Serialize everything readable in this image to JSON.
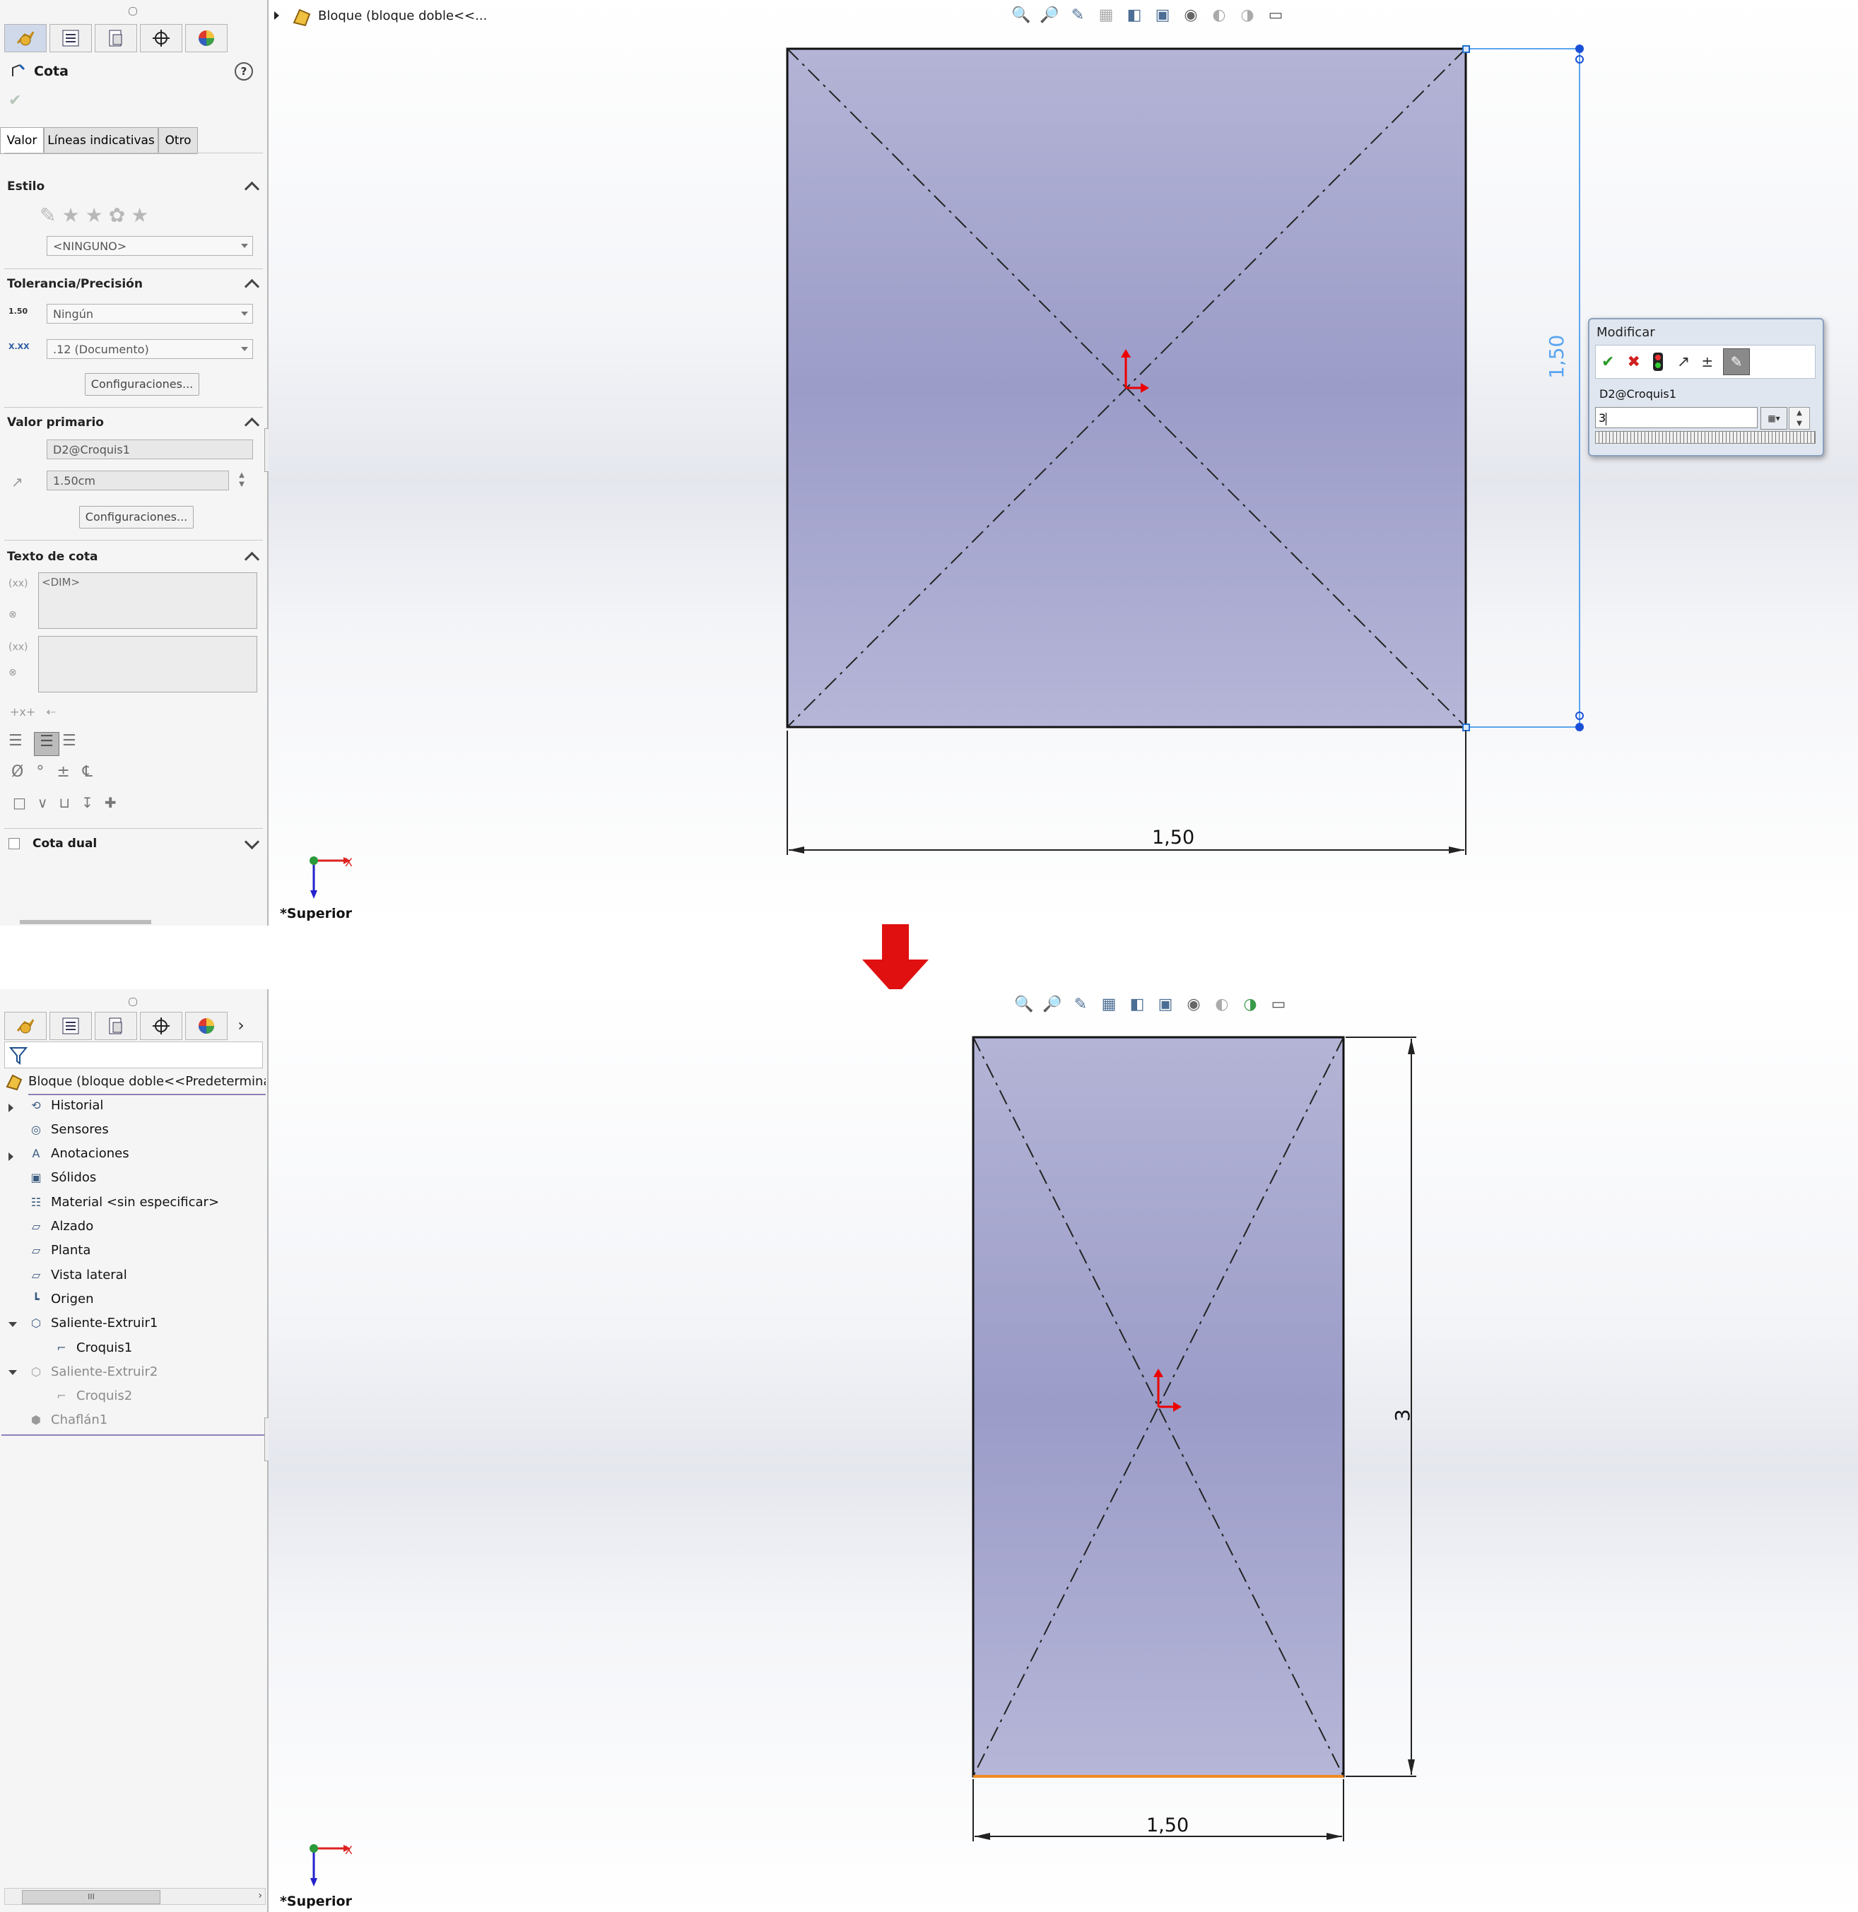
{
  "top": {
    "panel": {
      "title": "Cota",
      "help": "?",
      "tabs": [
        "Valor",
        "Líneas indicativas",
        "Otro"
      ],
      "estilo": {
        "title": "Estilo",
        "select": "<NINGUNO>"
      },
      "tolerancia": {
        "title": "Tolerancia/Precisión",
        "tol_select": "Ningún",
        "prec_select": ".12 (Documento)",
        "config_button": "Configuraciones...",
        "tol_icon_text": "1.50",
        "prec_icon_text": "X.XX"
      },
      "valor_primario": {
        "title": "Valor primario",
        "name": "D2@Croquis1",
        "value": "1.50cm",
        "config_button": "Configuraciones..."
      },
      "texto_cota": {
        "title": "Texto de cota",
        "text": "<DIM>"
      },
      "cota_dual": {
        "label": "Cota dual"
      },
      "symbols": [
        "Ø",
        "°",
        "±",
        "℄"
      ]
    },
    "breadcrumb": "Bloque  (bloque doble<<...",
    "dimension_h": "1,50",
    "dimension_v": "1,50",
    "view_label": "*Superior",
    "modify_dialog": {
      "title": "Modificar",
      "name": "D2@Croquis1",
      "value": "3"
    }
  },
  "bottom": {
    "tree": {
      "root": "Bloque  (bloque doble<<Predeterminado",
      "items": [
        {
          "label": "Historial",
          "icon": "history-icon"
        },
        {
          "label": "Sensores",
          "icon": "sensor-icon"
        },
        {
          "label": "Anotaciones",
          "icon": "annotation-icon"
        },
        {
          "label": "Sólidos",
          "icon": "solid-bodies-icon"
        },
        {
          "label": "Material <sin especificar>",
          "icon": "material-icon"
        },
        {
          "label": "Alzado",
          "icon": "plane-icon"
        },
        {
          "label": "Planta",
          "icon": "plane-icon"
        },
        {
          "label": "Vista lateral",
          "icon": "plane-icon"
        },
        {
          "label": "Origen",
          "icon": "origin-icon"
        },
        {
          "label": "Saliente-Extruir1",
          "icon": "extrude-icon"
        },
        {
          "label": "Croquis1",
          "icon": "sketch-icon"
        },
        {
          "label": "Saliente-Extruir2",
          "icon": "extrude-icon"
        },
        {
          "label": "Croquis2",
          "icon": "sketch-icon"
        },
        {
          "label": "Chaflán1",
          "icon": "chamfer-icon"
        }
      ]
    },
    "dimension_h": "1,50",
    "dimension_v": "3",
    "view_label": "*Superior",
    "scroll_grip": "III"
  }
}
